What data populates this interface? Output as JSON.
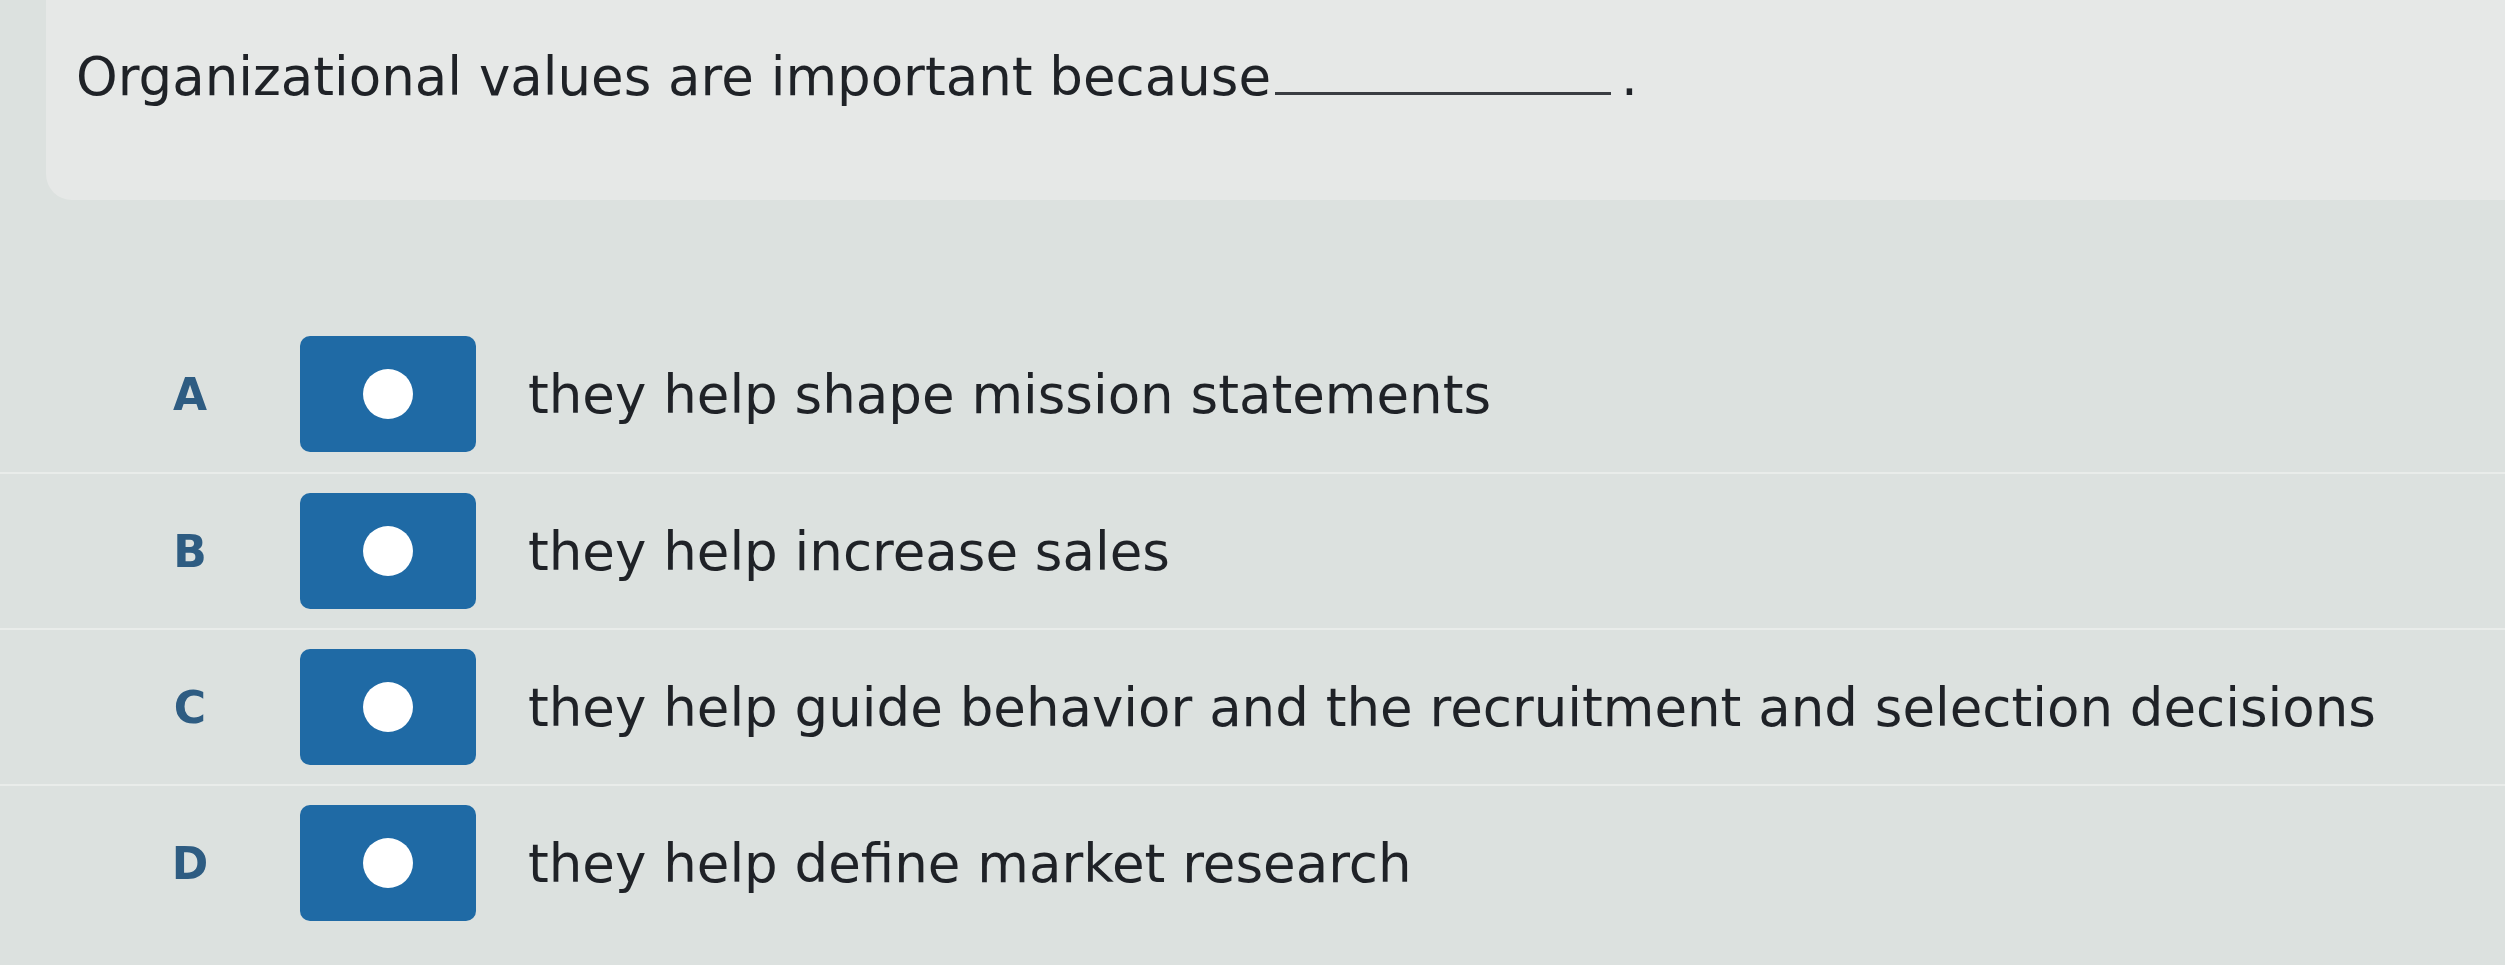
{
  "question": {
    "text_before_blank": "Organizational values are important because",
    "text_after_blank": "."
  },
  "options": [
    {
      "letter": "A",
      "text": "they help shape mission statements",
      "selected": false
    },
    {
      "letter": "B",
      "text": "they help increase sales",
      "selected": false
    },
    {
      "letter": "C",
      "text": "they help guide behavior and the recruitment and selection decisions",
      "selected": false
    },
    {
      "letter": "D",
      "text": "they help define market research",
      "selected": false
    }
  ]
}
